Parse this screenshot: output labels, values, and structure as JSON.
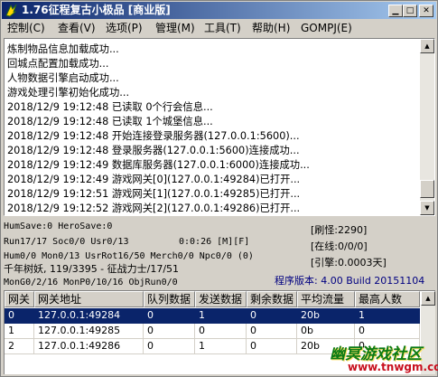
{
  "window": {
    "title": "1.76征程复古小极品 [商业版]"
  },
  "colors": {
    "titlebar_start": "#0a246a",
    "titlebar_end": "#a6caf0",
    "selection": "#0a246a",
    "version_text": "#000080"
  },
  "menu": {
    "items": [
      "控制(C)",
      "查看(V)",
      "选项(P)",
      "管理(M)",
      "工具(T)",
      "帮助(H)",
      "GOMPJ(E)"
    ]
  },
  "log": {
    "lines": [
      "炼制物品信息加载成功...",
      "回城点配置加载成功...",
      "人物数据引擎启动成功...",
      "游戏处理引擎初始化成功...",
      "2018/12/9 19:12:48 已读取 0个行会信息...",
      "2018/12/9 19:12:48 已读取 1个城堡信息...",
      "2018/12/9 19:12:48 开始连接登录服务器(127.0.0.1:5600)...",
      "2018/12/9 19:12:48 登录服务器(127.0.0.1:5600)连接成功...",
      "2018/12/9 19:12:49 数据库服务器(127.0.0.1:6000)连接成功...",
      "2018/12/9 19:12:49 游戏网关[0](127.0.0.1:49284)已打开...",
      "2018/12/9 19:12:51 游戏网关[1](127.0.0.1:49285)已打开...",
      "2018/12/9 19:12:52 游戏网关[2](127.0.0.1:49286)已打开..."
    ]
  },
  "status": {
    "line1": "HumSave:0 HeroSave:0",
    "line2": "Run17/17 Soc0/0 Usr0/13",
    "timer": "0:0:26 [M][F]",
    "line3": "Hum0/0 Mon0/13 UsrRot16/50 Merch0/0 Npc0/0 (0)",
    "line4": "千年树妖, 119/3395 - 征战力士/17/51",
    "line5": "MonG0/2/16 MonP0/10/16 ObjRun0/0",
    "refresh": "[刷怪:2290]",
    "online": "[在线:0/0/0]",
    "engine": "[引擎:0.0003天]",
    "version": "程序版本: 4.00 Build 20151104"
  },
  "table": {
    "columns": [
      "网关",
      "网关地址",
      "队列数据",
      "发送数据",
      "剩余数据",
      "平均流量",
      "最高人数"
    ],
    "rows": [
      [
        "0",
        "127.0.0.1:49284",
        "0",
        "1",
        "0",
        "20b",
        "1"
      ],
      [
        "1",
        "127.0.0.1:49285",
        "0",
        "0",
        "0",
        "0b",
        "0"
      ],
      [
        "2",
        "127.0.0.1:49286",
        "0",
        "1",
        "0",
        "20b",
        "0"
      ]
    ],
    "selected_row": 0
  },
  "watermark": {
    "main": "幽冥游戏社区",
    "sub": "www.tnwgm.com"
  }
}
